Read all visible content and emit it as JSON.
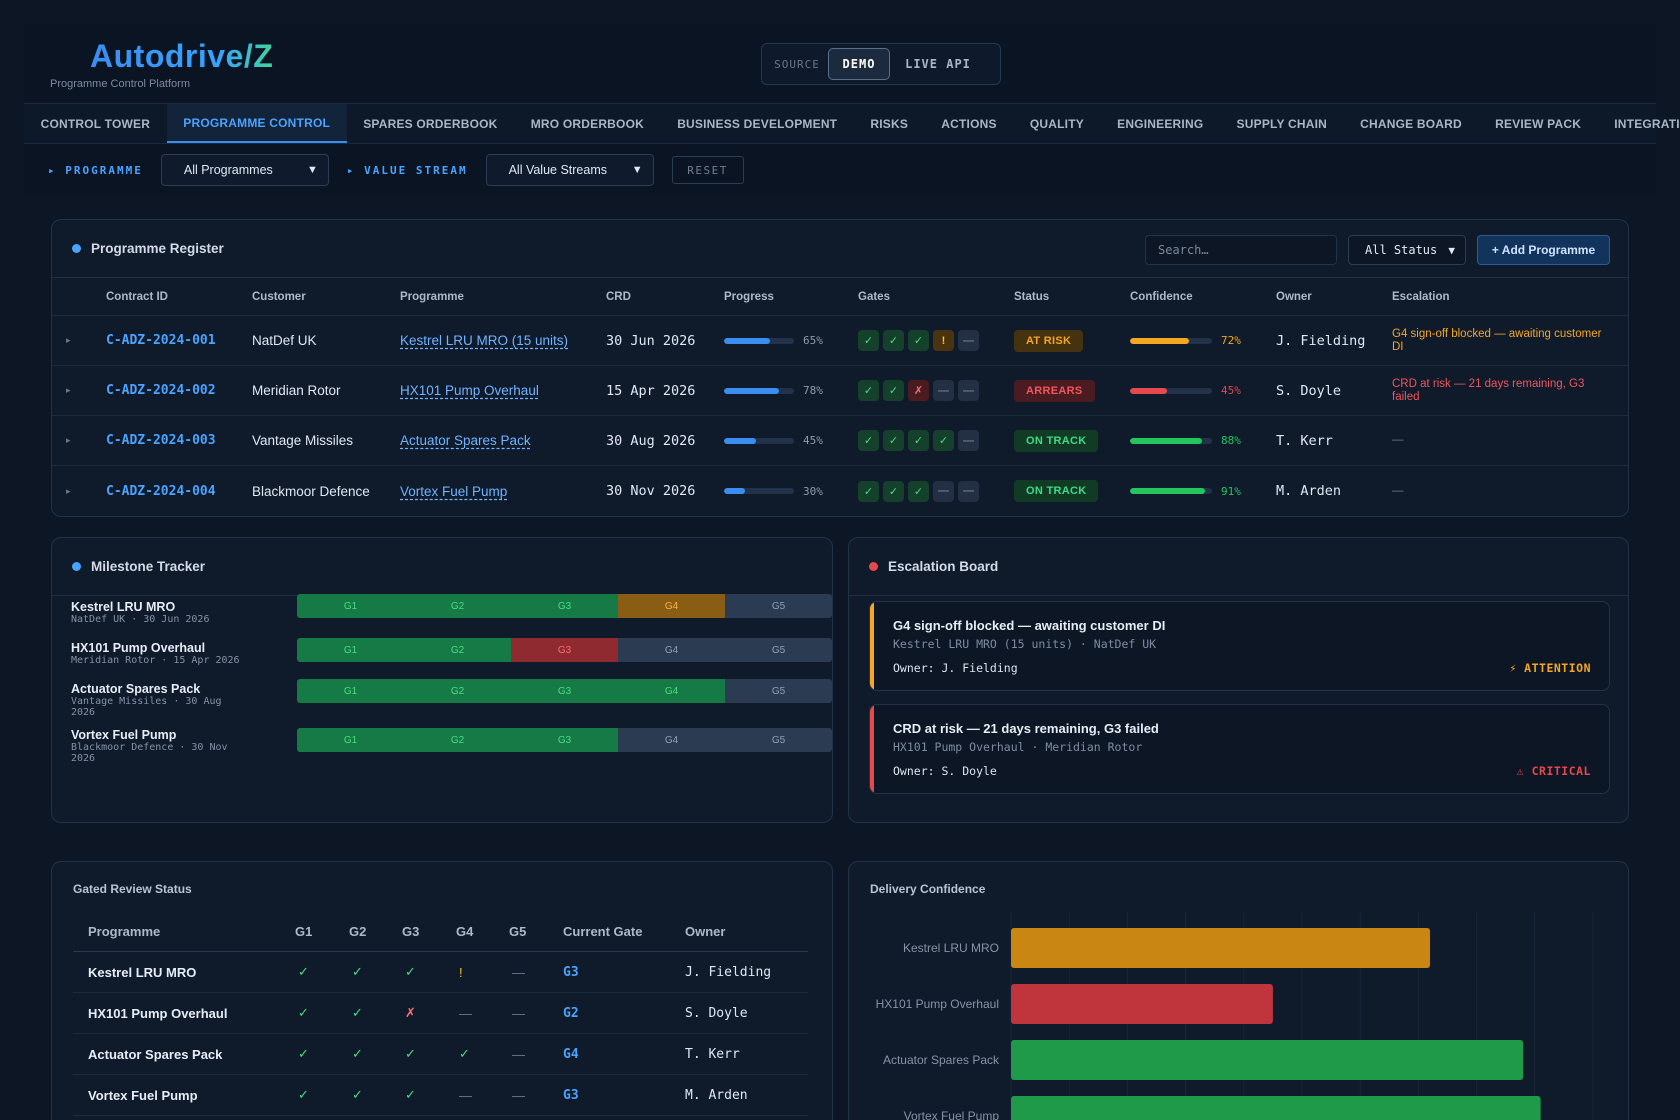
{
  "app": {
    "brand": "Autodrive/Z",
    "subtitle": "Programme Control Platform",
    "source_label": "SOURCE",
    "source_options": [
      "DEMO",
      "LIVE API"
    ],
    "source_selected": "DEMO"
  },
  "tabs": [
    {
      "label": "CONTROL TOWER",
      "active": false
    },
    {
      "label": "PROGRAMME CONTROL",
      "active": true
    },
    {
      "label": "SPARES ORDERBOOK",
      "active": false
    },
    {
      "label": "MRO ORDERBOOK",
      "active": false
    },
    {
      "label": "BUSINESS DEVELOPMENT",
      "active": false
    },
    {
      "label": "RISKS",
      "active": false
    },
    {
      "label": "ACTIONS",
      "active": false
    },
    {
      "label": "QUALITY",
      "active": false
    },
    {
      "label": "ENGINEERING",
      "active": false
    },
    {
      "label": "SUPPLY CHAIN",
      "active": false
    },
    {
      "label": "CHANGE BOARD",
      "active": false
    },
    {
      "label": "REVIEW PACK",
      "active": false
    },
    {
      "label": "INTEGRATIONS",
      "active": false
    }
  ],
  "filters": {
    "programme_label": "▸ PROGRAMME",
    "programme_value": "All Programmes",
    "value_stream_label": "▸ VALUE STREAM",
    "value_stream_value": "All Value Streams",
    "reset": "RESET"
  },
  "register": {
    "title": "Programme Register",
    "search_placeholder": "Search…",
    "status_filter": "All Status",
    "add_button": "+ Add Programme",
    "columns": [
      "Contract ID",
      "Customer",
      "Programme",
      "CRD",
      "Progress",
      "Gates",
      "Status",
      "Confidence",
      "Owner",
      "Escalation"
    ],
    "rows": [
      {
        "contract_id": "C-ADZ-2024-001",
        "customer": "NatDef UK",
        "programme": "Kestrel LRU MRO (15 units)",
        "crd": "30 Jun 2026",
        "progress": 65,
        "progress_label": "65%",
        "gates": [
          "pass",
          "pass",
          "pass",
          "warn",
          "none"
        ],
        "status": "AT RISK",
        "status_kind": "risk",
        "confidence": 72,
        "confidence_label": "72%",
        "confidence_color": "#f5a623",
        "owner": "J. Fielding",
        "escalation": "G4 sign-off blocked — awaiting customer DI",
        "escalation_color": "#f5a623"
      },
      {
        "contract_id": "C-ADZ-2024-002",
        "customer": "Meridian Rotor",
        "programme": "HX101 Pump Overhaul",
        "crd": "15 Apr 2026",
        "progress": 78,
        "progress_label": "78%",
        "gates": [
          "pass",
          "pass",
          "fail",
          "none",
          "none"
        ],
        "status": "ARREARS",
        "status_kind": "arrears",
        "confidence": 45,
        "confidence_label": "45%",
        "confidence_color": "#e5484d",
        "owner": "S. Doyle",
        "escalation": "CRD at risk — 21 days remaining, G3 failed",
        "escalation_color": "#f0565c"
      },
      {
        "contract_id": "C-ADZ-2024-003",
        "customer": "Vantage Missiles",
        "programme": "Actuator Spares Pack",
        "crd": "30 Aug 2026",
        "progress": 45,
        "progress_label": "45%",
        "gates": [
          "pass",
          "pass",
          "pass",
          "pass",
          "none"
        ],
        "status": "ON TRACK",
        "status_kind": "ok",
        "confidence": 88,
        "confidence_label": "88%",
        "confidence_color": "#22c55e",
        "owner": "T. Kerr",
        "escalation": "—",
        "escalation_color": "#6b7a90"
      },
      {
        "contract_id": "C-ADZ-2024-004",
        "customer": "Blackmoor Defence",
        "programme": "Vortex Fuel Pump",
        "crd": "30 Nov 2026",
        "progress": 30,
        "progress_label": "30%",
        "gates": [
          "pass",
          "pass",
          "pass",
          "none",
          "none"
        ],
        "status": "ON TRACK",
        "status_kind": "ok",
        "confidence": 91,
        "confidence_label": "91%",
        "confidence_color": "#22c55e",
        "owner": "M. Arden",
        "escalation": "—",
        "escalation_color": "#6b7a90"
      }
    ]
  },
  "milestones": {
    "title": "Milestone Tracker",
    "gate_labels": [
      "G1",
      "G2",
      "G3",
      "G4",
      "G5"
    ],
    "rows": [
      {
        "name": "Kestrel LRU MRO",
        "sub": "NatDef UK · 30 Jun 2026",
        "gates": [
          "pass",
          "pass",
          "pass",
          "warn",
          "none"
        ]
      },
      {
        "name": "HX101 Pump Overhaul",
        "sub": "Meridian Rotor · 15 Apr 2026",
        "gates": [
          "pass",
          "pass",
          "fail",
          "none",
          "none"
        ]
      },
      {
        "name": "Actuator Spares Pack",
        "sub": "Vantage Missiles · 30 Aug 2026",
        "gates": [
          "pass",
          "pass",
          "pass",
          "pass",
          "none"
        ]
      },
      {
        "name": "Vortex Fuel Pump",
        "sub": "Blackmoor Defence · 30 Nov 2026",
        "gates": [
          "pass",
          "pass",
          "pass",
          "none",
          "none"
        ]
      }
    ]
  },
  "escalations": {
    "title": "Escalation Board",
    "cards": [
      {
        "title": "G4 sign-off blocked — awaiting customer DI",
        "sub": "Kestrel LRU MRO (15 units) · NatDef UK",
        "owner": "Owner: J. Fielding",
        "severity": "⚡ ATTENTION",
        "color": "#f5a623"
      },
      {
        "title": "CRD at risk — 21 days remaining, G3 failed",
        "sub": "HX101 Pump Overhaul · Meridian Rotor",
        "owner": "Owner: S. Doyle",
        "severity": "⚠ CRITICAL",
        "color": "#e5484d"
      }
    ]
  },
  "gated_review": {
    "title": "Gated Review Status",
    "columns": [
      "Programme",
      "G1",
      "G2",
      "G3",
      "G4",
      "G5",
      "Current Gate",
      "Owner"
    ],
    "rows": [
      {
        "programme": "Kestrel LRU MRO",
        "gates": [
          "pass",
          "pass",
          "pass",
          "warn",
          "none"
        ],
        "current_gate": "G3",
        "owner": "J. Fielding"
      },
      {
        "programme": "HX101 Pump Overhaul",
        "gates": [
          "pass",
          "pass",
          "fail",
          "none",
          "none"
        ],
        "current_gate": "G2",
        "owner": "S. Doyle"
      },
      {
        "programme": "Actuator Spares Pack",
        "gates": [
          "pass",
          "pass",
          "pass",
          "pass",
          "none"
        ],
        "current_gate": "G4",
        "owner": "T. Kerr"
      },
      {
        "programme": "Vortex Fuel Pump",
        "gates": [
          "pass",
          "pass",
          "pass",
          "none",
          "none"
        ],
        "current_gate": "G3",
        "owner": "M. Arden"
      }
    ]
  },
  "chart_data": {
    "type": "bar",
    "orientation": "horizontal",
    "title": "Delivery Confidence",
    "categories": [
      "Kestrel LRU MRO",
      "HX101 Pump Overhaul",
      "Actuator Spares Pack",
      "Vortex Fuel Pump"
    ],
    "values": [
      72,
      45,
      88,
      91
    ],
    "colors": [
      "#c98612",
      "#c0343b",
      "#1f9a49",
      "#1f9a49"
    ],
    "xlim": [
      0,
      100
    ],
    "grid": true
  },
  "icons": {
    "gate_pass": "✓",
    "gate_fail": "✗",
    "gate_warn": "!",
    "gate_none": "—",
    "row_caret": "▸",
    "chevron": "⌄"
  }
}
